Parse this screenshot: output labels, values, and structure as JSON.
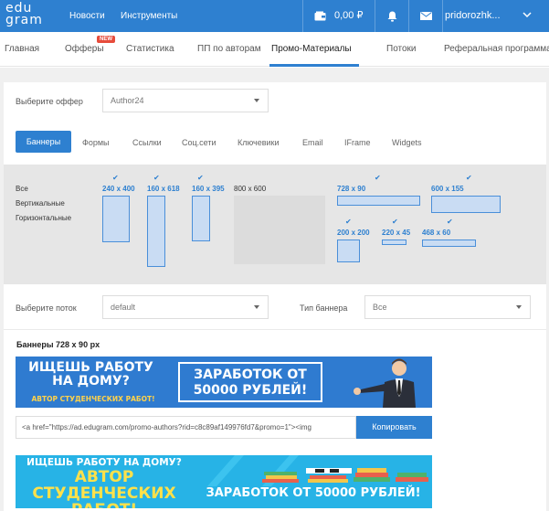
{
  "header": {
    "logo_top": "edu",
    "logo_bottom": "gram",
    "nav": [
      "Новости",
      "Инструменты"
    ],
    "balance": "0,00 ₽",
    "username": "pridorozhk..."
  },
  "subnav": {
    "items": [
      "Главная",
      "Офферы",
      "Статистика",
      "ПП по авторам",
      "Промо-Материалы",
      "Потоки",
      "Реферальная программа"
    ],
    "new_badge": "NEW",
    "active": "Промо-Материалы"
  },
  "offer": {
    "label": "Выберите оффер",
    "value": "Author24"
  },
  "tabs": [
    "Баннеры",
    "Формы",
    "Ссылки",
    "Соц.сети",
    "Ключевики",
    "Email",
    "IFrame",
    "Widgets"
  ],
  "filters": [
    "Все",
    "Вертикальные",
    "Горизонтальные"
  ],
  "sizes": [
    {
      "label": "240 x 400",
      "checked": true
    },
    {
      "label": "160 x 618",
      "checked": true
    },
    {
      "label": "160 x 395",
      "checked": true
    },
    {
      "label": "800 x 600",
      "checked": false
    },
    {
      "label": "728 x 90",
      "checked": true
    },
    {
      "label": "600 x 155",
      "checked": true
    },
    {
      "label": "200 x 200",
      "checked": true
    },
    {
      "label": "220 x 45",
      "checked": true
    },
    {
      "label": "468 x 60",
      "checked": true
    }
  ],
  "stream": {
    "label": "Выберите поток",
    "value": "default"
  },
  "banner_type": {
    "label": "Тип баннера",
    "value": "Все"
  },
  "section_title": "Баннеры 728 x 90 px",
  "banner1": {
    "question": "ИЩЕШЬ РАБОТУ НА ДОМУ?",
    "subtitle": "АВТОР СТУДЕНЧЕСКИХ РАБОТ!",
    "earn": "ЗАРАБОТОК ОТ 50000 РУБЛЕЙ!"
  },
  "code": {
    "value": "<a href=\"https://ad.edugram.com/promo-authors?rid=c8c89af149976fd7&promo=1\"><img",
    "copy_label": "Копировать"
  },
  "banner2": {
    "question": "ИЩЕШЬ РАБОТУ НА ДОМУ?",
    "author": "АВТОР СТУДЕНЧЕСКИХ РАБОТ!",
    "earn": "ЗАРАБОТОК ОТ 50000 РУБЛЕЙ!"
  },
  "colors": {
    "brand": "#2e80d0",
    "banner_yellow": "#ffd24a",
    "banner2_bg": "#27b3e6"
  }
}
